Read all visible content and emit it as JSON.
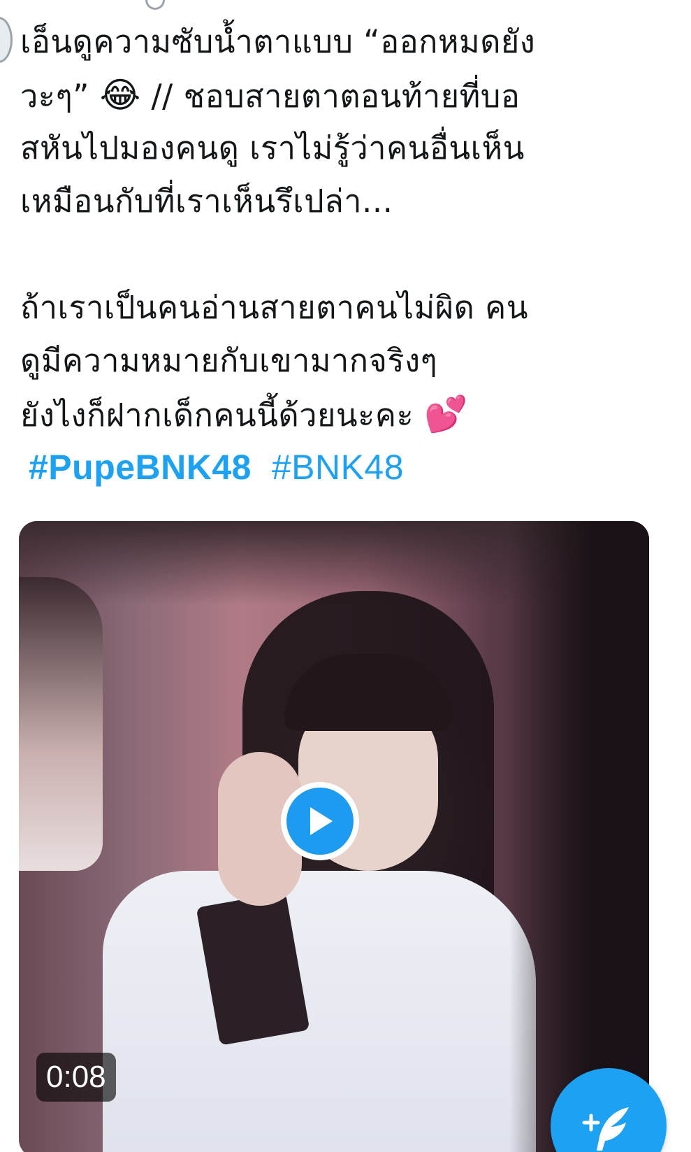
{
  "tweet": {
    "lines": [
      "เอ็นดูความซับน้ำตาแบบ “ออกหมดยัง",
      "วะๆ”",
      "// ชอบสายตาตอนท้ายที่บอ",
      "สหันไปมองคนดู เราไม่รู้ว่าคนอื่นเห็น",
      "เหมือนกับที่เราเห็นรึเปล่า...",
      "ถ้าเราเป็นคนอ่านสายตาคนไม่ผิด คน",
      "ดูมีความหมายกับเขามากจริงๆ",
      "ยังไงก็ฝากเด็กคนนี้ด้วยนะคะ"
    ],
    "emoji_laugh": "😂",
    "emoji_hearts": "💕",
    "hashtags": [
      "#PupeBNK48",
      "#BNK48"
    ]
  },
  "video": {
    "duration": "0:08",
    "play_icon": "play-icon"
  },
  "fab": {
    "icon": "compose-tweet-icon"
  },
  "colors": {
    "link": "#1da1f2",
    "play": "#1d9bf0",
    "fab": "#1da1f2",
    "text": "#14171a"
  }
}
